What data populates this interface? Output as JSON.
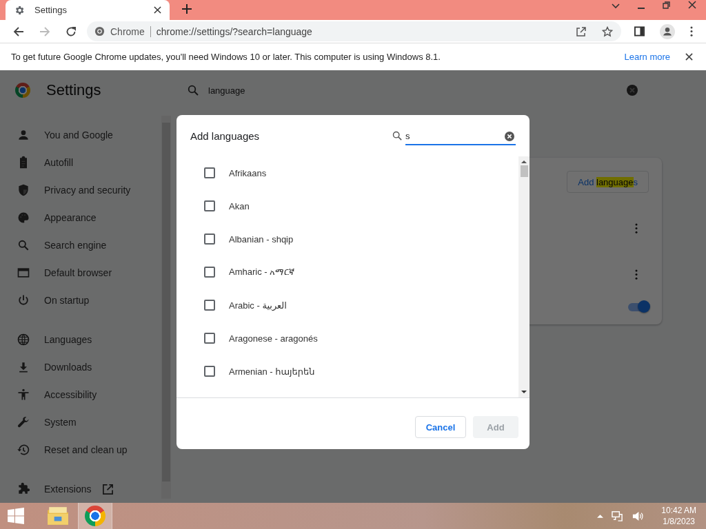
{
  "browser_tab": {
    "title": "Settings",
    "selected": true
  },
  "toolbar": {
    "forward_disabled": true,
    "omnibox": {
      "site_label": "Chrome",
      "url": "chrome://settings/?search=language"
    }
  },
  "infobar": {
    "message": "To get future Google Chrome updates, you'll need Windows 10 or later. This computer is using Windows 8.1.",
    "link": "Learn more"
  },
  "settings": {
    "title": "Settings",
    "search": {
      "value": "language"
    },
    "sidebar": {
      "groups": [
        [
          {
            "label": "You and Google",
            "kind": "person"
          },
          {
            "label": "Autofill",
            "kind": "clipboard"
          },
          {
            "label": "Privacy and security",
            "kind": "shield"
          },
          {
            "label": "Appearance",
            "kind": "palette"
          },
          {
            "label": "Search engine",
            "kind": "search"
          },
          {
            "label": "Default browser",
            "kind": "browser"
          },
          {
            "label": "On startup",
            "kind": "power"
          }
        ],
        [
          {
            "label": "Languages",
            "kind": "globe"
          },
          {
            "label": "Downloads",
            "kind": "download"
          },
          {
            "label": "Accessibility",
            "kind": "accessibility"
          },
          {
            "label": "System",
            "kind": "wrench"
          },
          {
            "label": "Reset and clean up",
            "kind": "history"
          }
        ],
        [
          {
            "label": "Extensions",
            "kind": "extensions"
          }
        ]
      ]
    },
    "card": {
      "add_button": {
        "label_before": "Add ",
        "label_match": "language",
        "label_after": "s"
      },
      "toggle": {
        "on": true
      }
    }
  },
  "dialog": {
    "title": "Add languages",
    "search": {
      "value": "s"
    },
    "languages": [
      {
        "label": "Afrikaans",
        "checked": false
      },
      {
        "label": "Akan",
        "checked": false
      },
      {
        "label": "Albanian - shqip",
        "checked": false
      },
      {
        "label": "Amharic - አማርኛ",
        "checked": false
      },
      {
        "label": "Arabic - العربية",
        "checked": false
      },
      {
        "label": "Aragonese - aragonés",
        "checked": false
      },
      {
        "label": "Armenian - հայերեն",
        "checked": false
      }
    ],
    "buttons": [
      {
        "label": "Cancel",
        "disabled": false
      },
      {
        "label": "Add",
        "disabled": true
      }
    ]
  },
  "taskbar": {
    "apps": [
      {
        "kind": "explorer",
        "selected": false
      },
      {
        "kind": "chrome",
        "selected": true
      }
    ],
    "time": "10:42 AM",
    "date": "1/8/2023"
  }
}
